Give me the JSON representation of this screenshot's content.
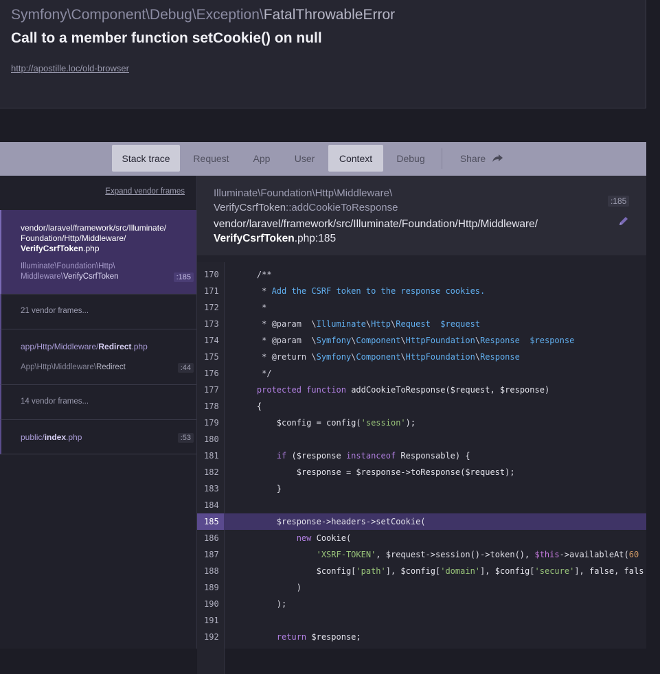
{
  "exception": {
    "namespace": "Symfony\\Component\\Debug\\Exception\\",
    "class_name": "FatalThrowableError",
    "message": "Call to a member function setCookie() on null",
    "url": "http://apostille.loc/old-browser"
  },
  "tabs": [
    {
      "label": "Stack trace",
      "active": true
    },
    {
      "label": "Request",
      "active": false
    },
    {
      "label": "App",
      "active": false
    },
    {
      "label": "User",
      "active": false
    },
    {
      "label": "Context",
      "active": true
    },
    {
      "label": "Debug",
      "active": false
    },
    {
      "label": "Share",
      "active": false
    }
  ],
  "frames_panel": {
    "expand_label": "Expand vendor frames",
    "frames": [
      {
        "file_line1": "vendor/laravel/framework/src/Illuminate/",
        "file_line2": "Foundation/Http/Middleware/",
        "file_bold": "VerifyCsrfToken",
        "file_ext": ".php",
        "class_line1": "Illuminate\\Foundation\\Http\\",
        "class_prefix": "Middleware\\",
        "class_bold": "VerifyCsrfToken",
        "line": ":185"
      },
      {
        "vendor_label": "21 vendor frames..."
      },
      {
        "file_prefix": "app/Http/Middleware/",
        "file_bold": "Redirect",
        "file_ext": ".php",
        "class_prefix": "App\\Http\\Middleware\\",
        "class_bold": "Redirect",
        "line": ":44"
      },
      {
        "vendor_label": "14 vendor frames..."
      },
      {
        "file_prefix": "public/",
        "file_bold": "index",
        "file_ext": ".php",
        "line": ":53"
      }
    ]
  },
  "detail": {
    "class_line1": "Illuminate\\Foundation\\Http\\Middleware\\",
    "class_name": "VerifyCsrfToken",
    "method": "::addCookieToResponse",
    "line_badge": ":185",
    "path_prefix": "vendor/laravel/framework/src/Illuminate/Foundation/Http/Middleware/",
    "path_bold": "VerifyCsrfToken",
    "path_suffix": ".php:185"
  },
  "code": {
    "highlight_line": 185,
    "lines": [
      {
        "n": 170,
        "text": "    /**"
      },
      {
        "n": 171,
        "text": "     * Add the CSRF token to the response cookies."
      },
      {
        "n": 172,
        "text": "     *"
      },
      {
        "n": 173,
        "text": "     * @param  \\Illuminate\\Http\\Request  $request"
      },
      {
        "n": 174,
        "text": "     * @param  \\Symfony\\Component\\HttpFoundation\\Response  $response"
      },
      {
        "n": 175,
        "text": "     * @return \\Symfony\\Component\\HttpFoundation\\Response"
      },
      {
        "n": 176,
        "text": "     */"
      },
      {
        "n": 177,
        "text": "    protected function addCookieToResponse($request, $response)"
      },
      {
        "n": 178,
        "text": "    {"
      },
      {
        "n": 179,
        "text": "        $config = config('session');"
      },
      {
        "n": 180,
        "text": ""
      },
      {
        "n": 181,
        "text": "        if ($response instanceof Responsable) {"
      },
      {
        "n": 182,
        "text": "            $response = $response->toResponse($request);"
      },
      {
        "n": 183,
        "text": "        }"
      },
      {
        "n": 184,
        "text": ""
      },
      {
        "n": 185,
        "text": "        $response->headers->setCookie("
      },
      {
        "n": 186,
        "text": "            new Cookie("
      },
      {
        "n": 187,
        "text": "                'XSRF-TOKEN', $request->session()->token(), $this->availableAt(60"
      },
      {
        "n": 188,
        "text": "                $config['path'], $config['domain'], $config['secure'], false, fals"
      },
      {
        "n": 189,
        "text": "            )"
      },
      {
        "n": 190,
        "text": "        );"
      },
      {
        "n": 191,
        "text": ""
      },
      {
        "n": 192,
        "text": "        return $response;"
      }
    ]
  },
  "colors": {
    "accent": "#7a6ab5",
    "highlight": "#3f3466",
    "tabbar": "#9b9ab1"
  }
}
